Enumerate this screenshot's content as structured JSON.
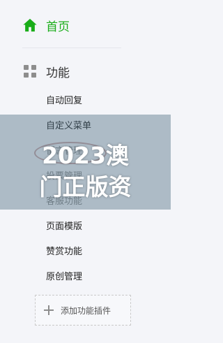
{
  "nav": {
    "home": {
      "label": "首页",
      "icon": "home-icon",
      "color": "#1aad19"
    },
    "function_section": {
      "label": "功能",
      "icon": "grid-icon"
    }
  },
  "menu": {
    "items": [
      {
        "label": "自动回复"
      },
      {
        "label": "自定义菜单"
      },
      {
        "label": "留言管理"
      },
      {
        "label": "投票管理"
      },
      {
        "label": "客服功能"
      },
      {
        "label": "页面模版"
      },
      {
        "label": "赞赏功能"
      },
      {
        "label": "原创管理"
      }
    ],
    "add_plugin_label": "添加功能插件"
  },
  "overlay": {
    "text_line1": "2023澳",
    "text_line2": "门正版资",
    "color": "#ffffff"
  }
}
